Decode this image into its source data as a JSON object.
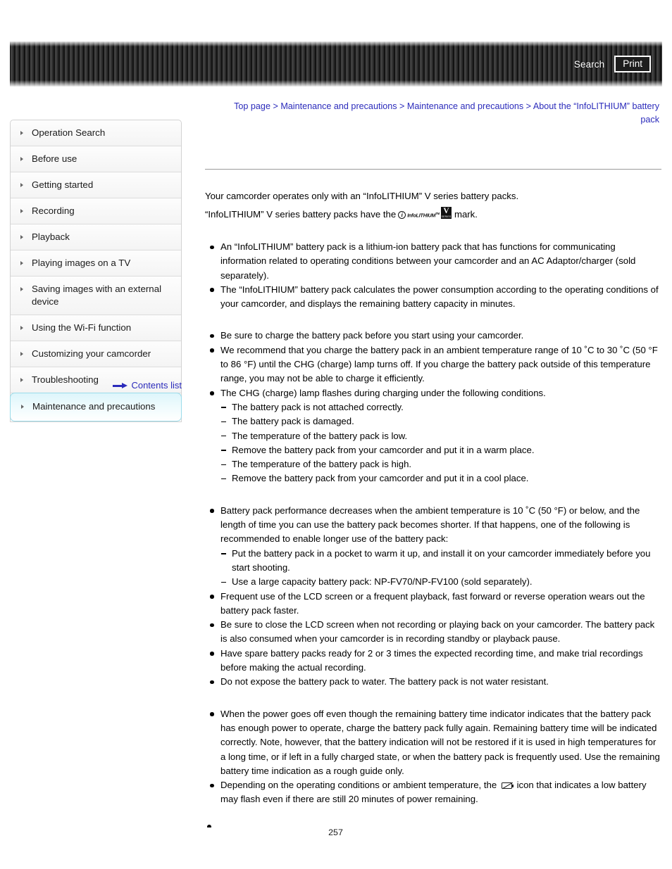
{
  "header": {
    "search_label": "Search",
    "print_label": "Print"
  },
  "breadcrumb": {
    "items": [
      "Top page",
      "Maintenance and precautions",
      "Maintenance and precautions",
      "About the “InfoLITHIUM” battery pack"
    ],
    "separator": ">"
  },
  "sidebar": {
    "items": [
      {
        "label": "Operation Search",
        "active": false
      },
      {
        "label": "Before use",
        "active": false
      },
      {
        "label": "Getting started",
        "active": false
      },
      {
        "label": "Recording",
        "active": false
      },
      {
        "label": "Playback",
        "active": false
      },
      {
        "label": "Playing images on a TV",
        "active": false
      },
      {
        "label": "Saving images with an external device",
        "active": false
      },
      {
        "label": "Using the Wi-Fi function",
        "active": false
      },
      {
        "label": "Customizing your camcorder",
        "active": false
      },
      {
        "label": "Troubleshooting",
        "active": false
      },
      {
        "label": "Maintenance and precautions",
        "active": true
      }
    ],
    "contents_list_label": "Contents list"
  },
  "content": {
    "intro_line_1": "Your camcorder operates only with an “InfoLITHIUM” V series battery packs.",
    "intro_line_2_before": "“InfoLITHIUM” V series battery packs have the",
    "intro_line_2_after": "mark.",
    "logo": {
      "circle_letter": "i",
      "wordmark": "InfoLITHIUM",
      "trademark": "TM",
      "box_letter": "V",
      "box_sub": "SERIES"
    },
    "group_1": [
      "An “InfoLITHIUM” battery pack is a lithium-ion battery pack that has functions for communicating information related to operating conditions between your camcorder and an AC Adaptor/charger (sold separately).",
      "The “InfoLITHIUM” battery pack calculates the power consumption according to the operating conditions of your camcorder, and displays the remaining battery capacity in minutes."
    ],
    "group_2": {
      "b1": "Be sure to charge the battery pack before you start using your camcorder.",
      "b2": "We recommend that you charge the battery pack in an ambient temperature range of 10 ˚C to 30 ˚C (50 °F to 86 °F) until the CHG (charge) lamp turns off. If you charge the battery pack outside of this temperature range, you may not be able to charge it efficiently.",
      "b3": "The CHG (charge) lamp flashes during charging under the following conditions.",
      "b3_subs": [
        "The battery pack is not attached correctly.",
        "The battery pack is damaged.",
        "The temperature of the battery pack is low.",
        "Remove the battery pack from your camcorder and put it in a warm place.",
        "The temperature of the battery pack is high.",
        "Remove the battery pack from your camcorder and put it in a cool place."
      ]
    },
    "group_3": {
      "b1": "Battery pack performance decreases when the ambient temperature is 10 ˚C (50 °F) or below, and the length of time you can use the battery pack becomes shorter. If that happens, one of the following is recommended to enable longer use of the battery pack:",
      "b1_subs": [
        "Put the battery pack in a pocket to warm it up, and install it on your camcorder immediately before you start shooting.",
        "Use a large capacity battery pack: NP-FV70/NP-FV100 (sold separately)."
      ],
      "b2": "Frequent use of the LCD screen or a frequent playback, fast forward or reverse operation wears out the battery pack faster.",
      "b3": "Be sure to close the LCD screen when not recording or playing back on your camcorder. The battery pack is also consumed when your camcorder is in recording standby or playback pause.",
      "b4": "Have spare battery packs ready for 2 or 3 times the expected recording time, and make trial recordings before making the actual recording.",
      "b5": "Do not expose the battery pack to water. The battery pack is not water resistant."
    },
    "group_4": {
      "b1": "When the power goes off even though the remaining battery time indicator indicates that the battery pack has enough power to operate, charge the battery pack fully again. Remaining battery time will be indicated correctly. Note, however, that the battery indication will not be restored if it is used in high temperatures for a long time, or if left in a fully charged state, or when the battery pack is frequently used. Use the remaining battery time indication as a rough guide only.",
      "b2_before": "Depending on the operating conditions or ambient temperature, the",
      "b2_after": "icon that indicates a low battery may flash even if there are still 20 minutes of power remaining."
    }
  },
  "footer": {
    "page_number": "257"
  },
  "colors": {
    "link": "#2b2bbb",
    "header_bar_dark": "#1a1a1a",
    "active_nav": "#ddf5fb",
    "rule": "#9a9a9a"
  }
}
